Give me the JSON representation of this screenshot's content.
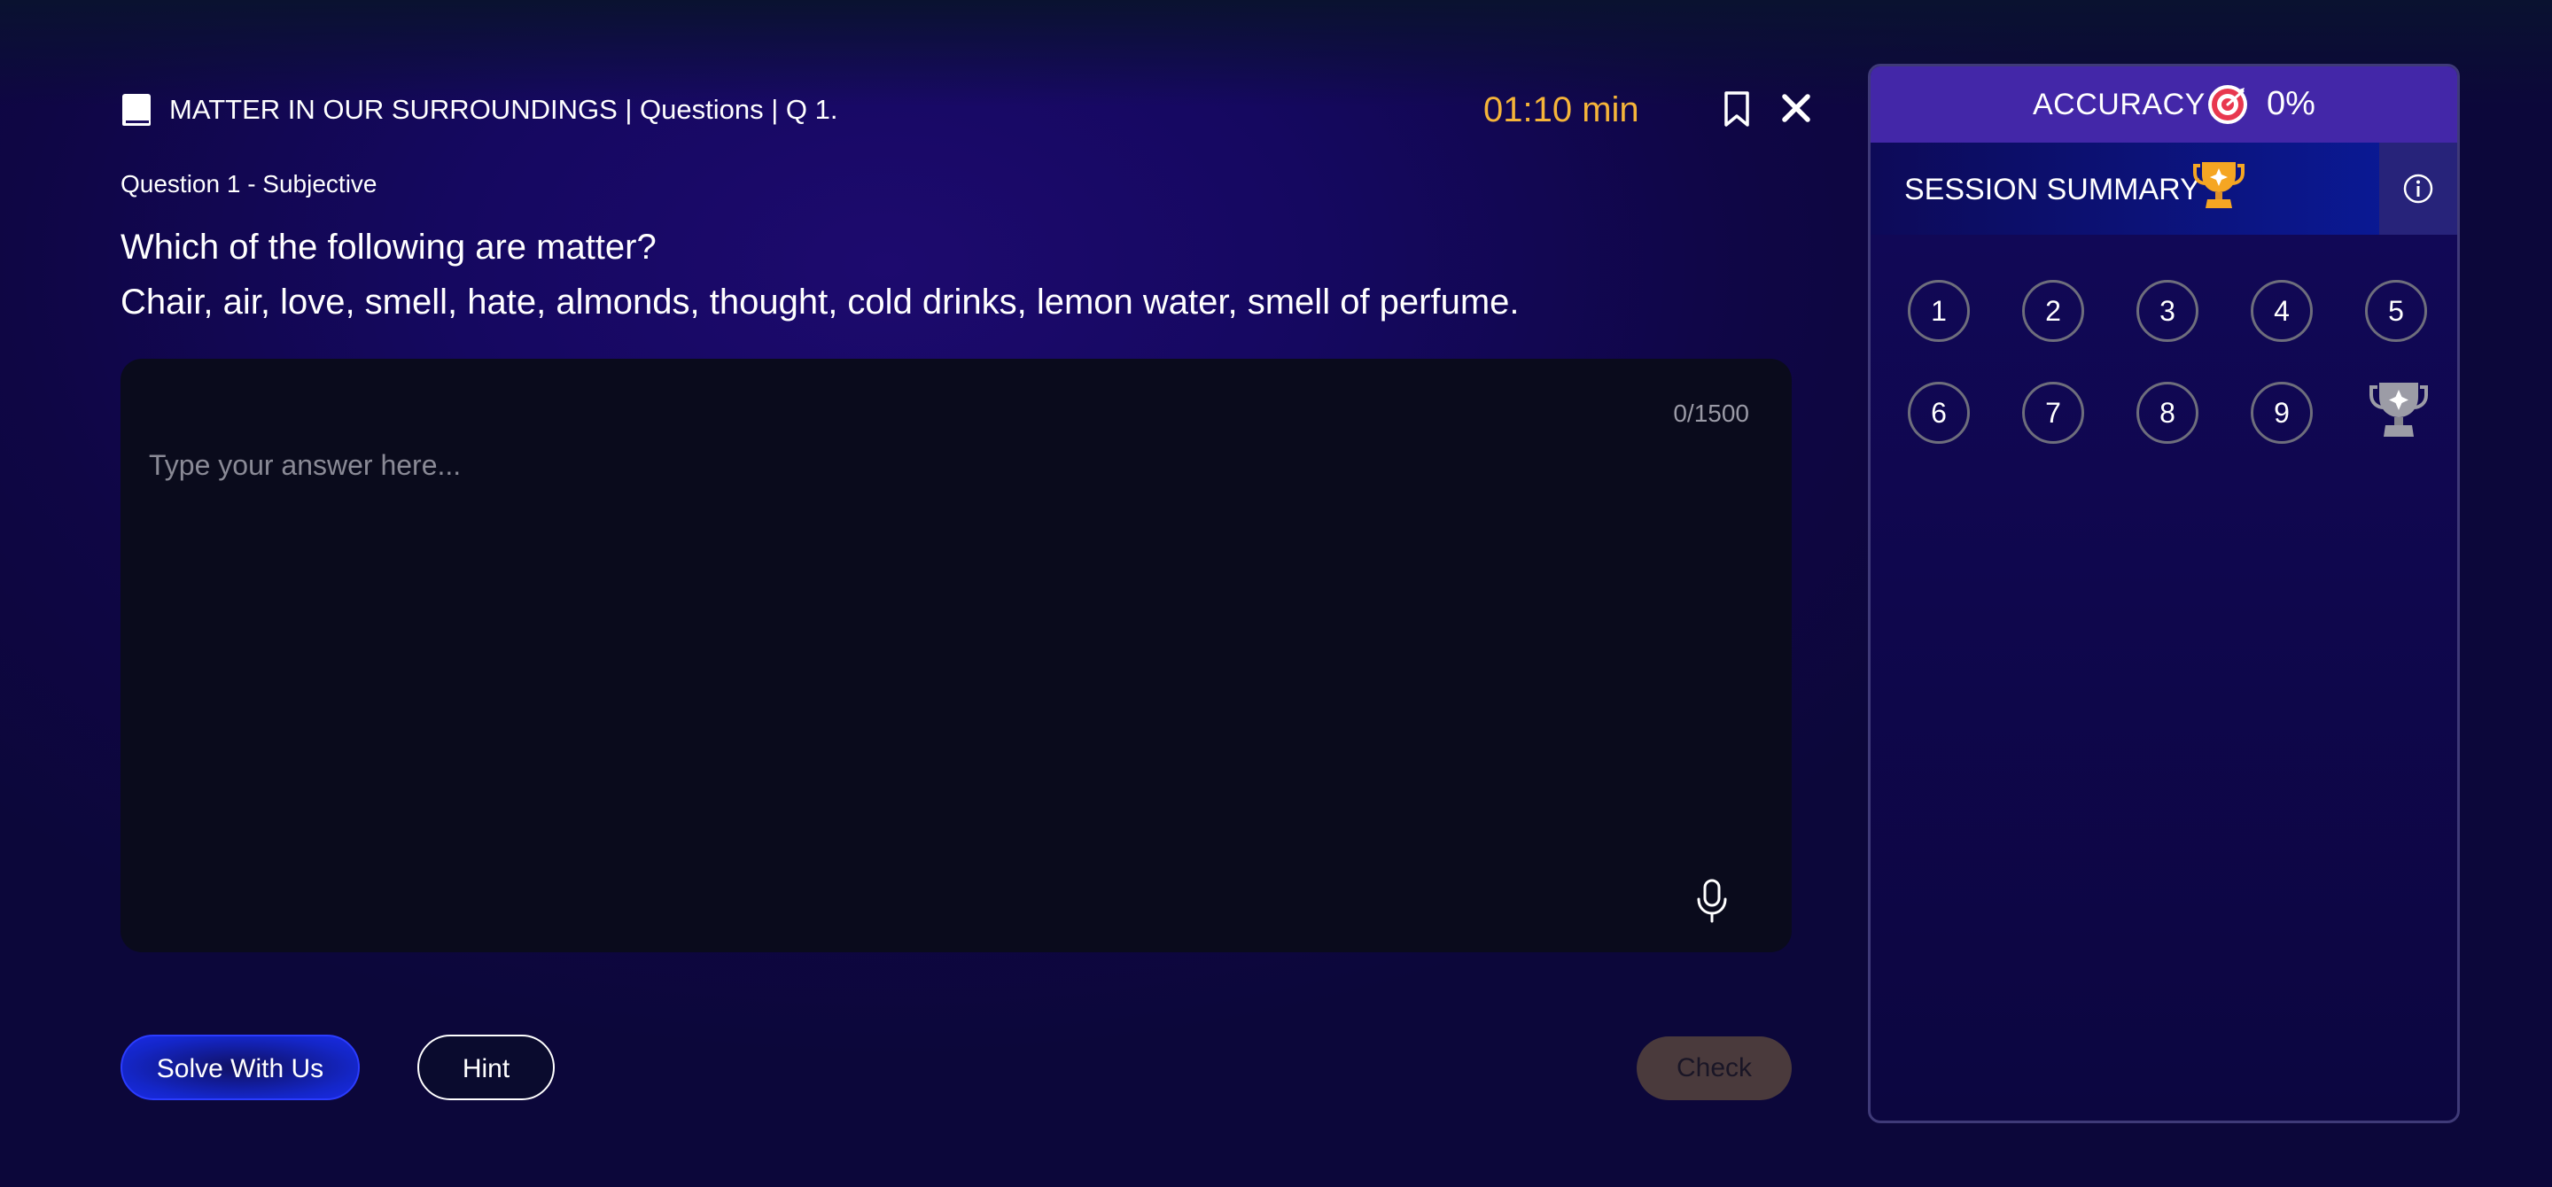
{
  "header": {
    "title": "MATTER IN OUR SURROUNDINGS | Questions | Q 1.",
    "timer": "01:10 min",
    "icons": {
      "book": "book-icon",
      "bookmark": "bookmark-icon",
      "close": "close-icon"
    }
  },
  "question": {
    "type_label": "Question 1 - Subjective",
    "line1": "Which of the following are matter?",
    "line2": "Chair, air, love, smell, hate, almonds, thought, cold drinks, lemon water, smell of perfume."
  },
  "answer": {
    "char_count": "0/1500",
    "placeholder": "Type your answer here...",
    "value": "",
    "icons": {
      "mic": "microphone-icon"
    }
  },
  "actions": {
    "solve_label": "Solve With Us",
    "hint_label": "Hint",
    "check_label": "Check"
  },
  "panel": {
    "accuracy_label": "ACCURACY",
    "accuracy_value": "0%",
    "summary_label": "SESSION SUMMARY",
    "question_numbers": [
      "1",
      "2",
      "3",
      "4",
      "5",
      "6",
      "7",
      "8",
      "9"
    ],
    "icons": {
      "target": "target-icon",
      "trophy": "trophy-icon",
      "info": "info-icon",
      "final": "silver-trophy-icon"
    }
  },
  "colors": {
    "accent_timer": "#f5b43a",
    "accuracy_bar": "#4327a8",
    "solve_button": "#1426c8",
    "check_button": "#4a3a3c",
    "trophy_gold": "#f5a623"
  }
}
